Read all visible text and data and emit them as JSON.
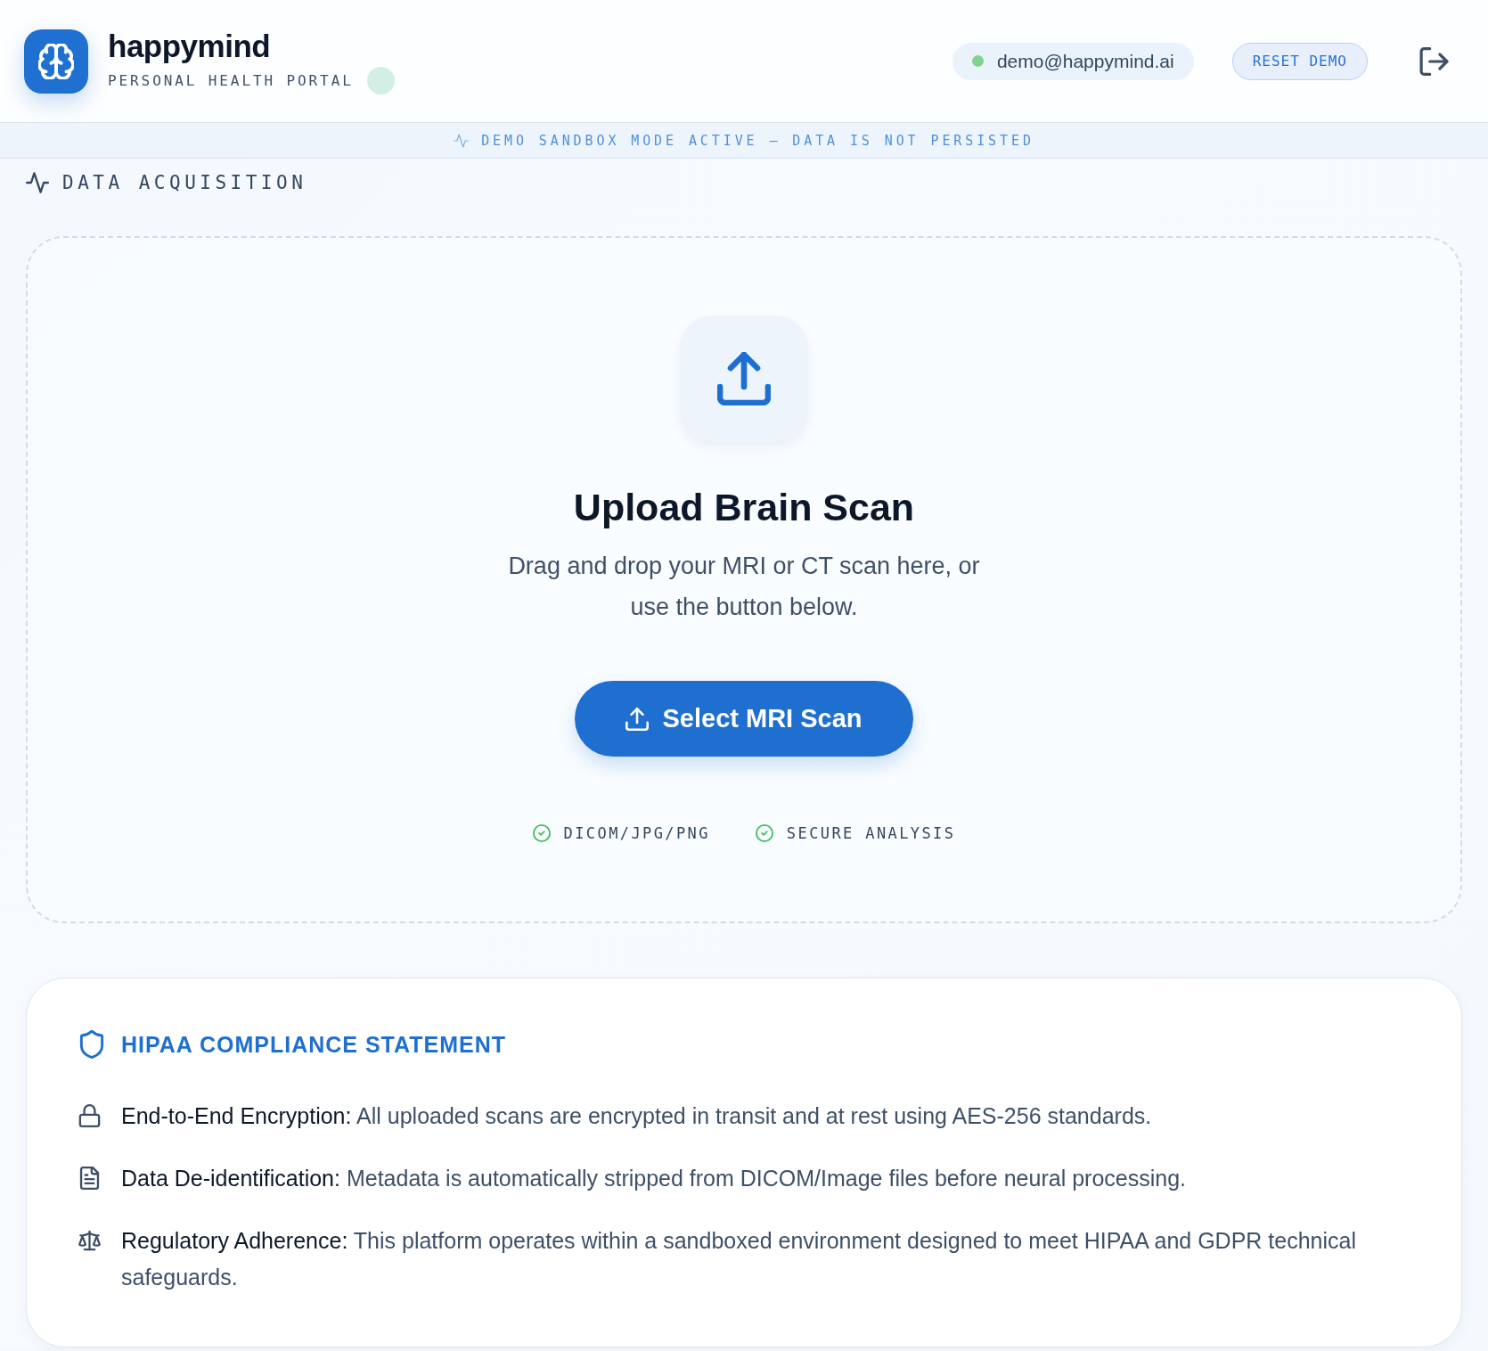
{
  "header": {
    "app_name": "happymind",
    "subtitle": "PERSONAL HEALTH PORTAL",
    "user": {
      "email": "demo@happymind.ai",
      "online": true
    },
    "reset_button": "RESET DEMO"
  },
  "banner": {
    "text": "DEMO SANDBOX MODE ACTIVE — DATA IS NOT PERSISTED"
  },
  "section": {
    "title": "DATA ACQUISITION"
  },
  "upload": {
    "title": "Upload Brain Scan",
    "description": "Drag and drop your MRI or CT scan here, or use the button below.",
    "button": "Select MRI Scan",
    "features": [
      "DICOM/JPG/PNG",
      "SECURE ANALYSIS"
    ]
  },
  "compliance": {
    "title": "HIPAA COMPLIANCE STATEMENT",
    "items": [
      {
        "kind": "encryption",
        "title": "End-to-End Encryption:",
        "text": "All uploaded scans are encrypted in transit and at rest using AES-256 standards."
      },
      {
        "kind": "deidentification",
        "title": "Data De-identification:",
        "text": "Metadata is automatically stripped from DICOM/Image files before neural processing."
      },
      {
        "kind": "regulatory",
        "title": "Regulatory Adherence:",
        "text": "This platform operates within a sandboxed environment designed to meet HIPAA and GDPR technical safeguards."
      }
    ]
  }
}
